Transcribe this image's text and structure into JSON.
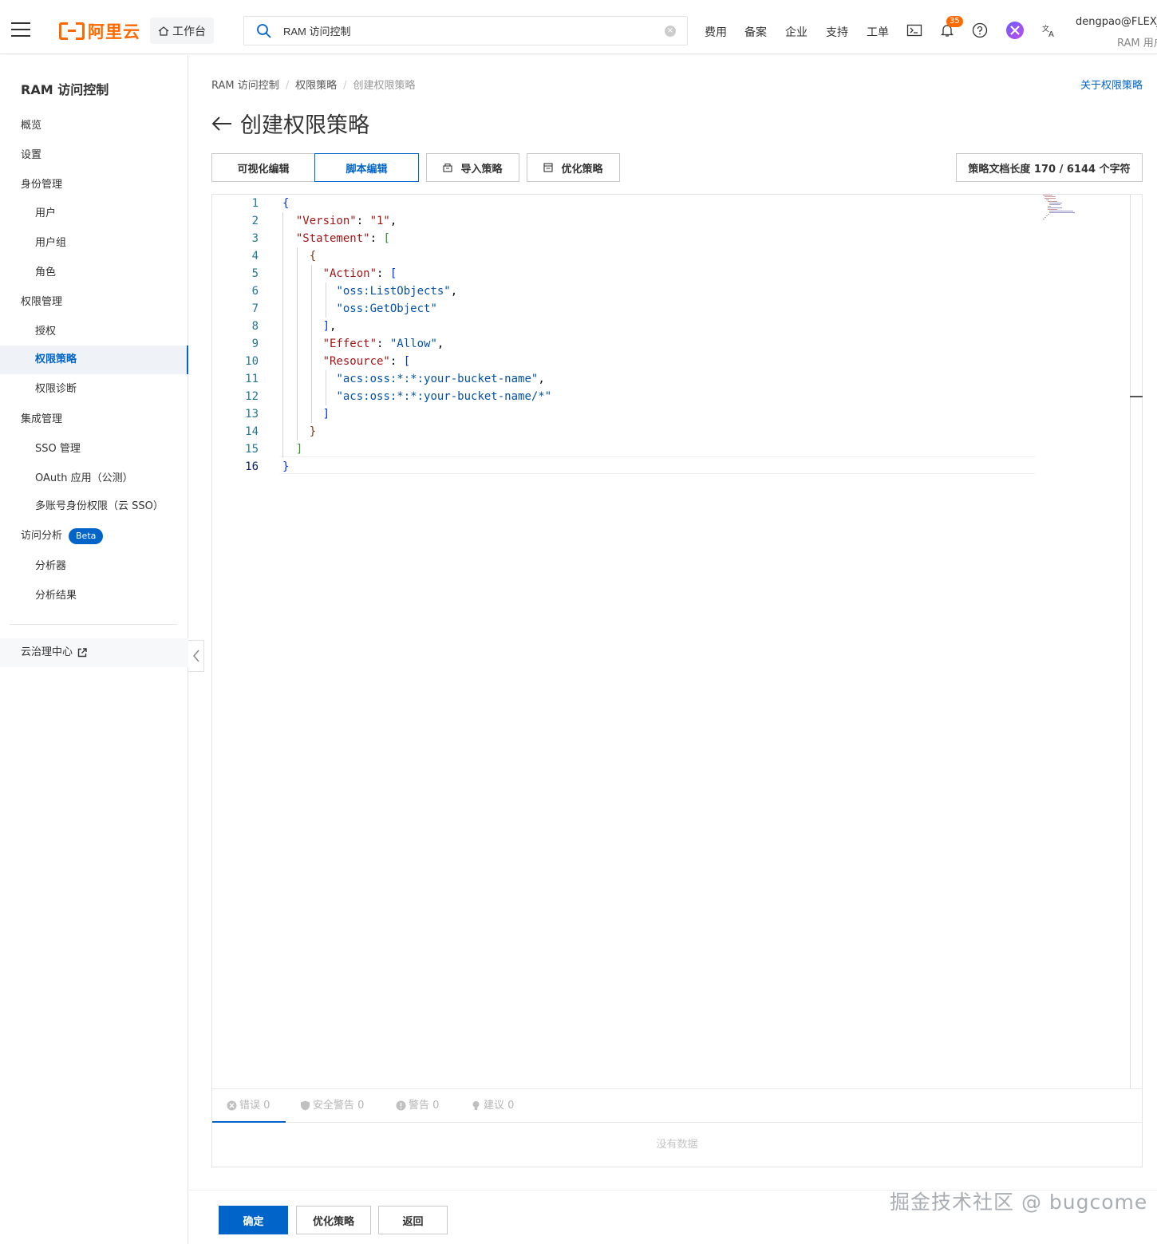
{
  "topbar": {
    "logo_text": "阿里云",
    "workbench_label": "工作台",
    "search_value": "RAM 访问控制",
    "nav": [
      "费用",
      "备案",
      "企业",
      "支持",
      "工单"
    ],
    "notification_count": "35",
    "username": "dengpao@FLEXJ",
    "user_sub": "RAM 用户"
  },
  "sidebar": {
    "title": "RAM 访问控制",
    "items": [
      {
        "label": "概览",
        "level": 1
      },
      {
        "label": "设置",
        "level": 1
      },
      {
        "label": "身份管理",
        "level": 1
      },
      {
        "label": "用户",
        "level": 2
      },
      {
        "label": "用户组",
        "level": 2
      },
      {
        "label": "角色",
        "level": 2
      },
      {
        "label": "权限管理",
        "level": 1
      },
      {
        "label": "授权",
        "level": 2
      },
      {
        "label": "权限策略",
        "level": 2,
        "active": true
      },
      {
        "label": "权限诊断",
        "level": 2
      },
      {
        "label": "集成管理",
        "level": 1
      },
      {
        "label": "SSO 管理",
        "level": 2
      },
      {
        "label": "OAuth 应用（公测）",
        "level": 2
      },
      {
        "label": "多账号身份权限（云 SSO）",
        "level": 2
      },
      {
        "label": "访问分析",
        "level": 1,
        "badge": "Beta"
      },
      {
        "label": "分析器",
        "level": 2
      },
      {
        "label": "分析结果",
        "level": 2
      }
    ],
    "external_link": "云治理中心"
  },
  "main": {
    "breadcrumb": [
      "RAM 访问控制",
      "权限策略",
      "创建权限策略"
    ],
    "about_link": "关于权限策略",
    "page_title": "创建权限策略",
    "tabs": {
      "visual": "可视化编辑",
      "script": "脚本编辑",
      "import": "导入策略",
      "optimize": "优化策略"
    },
    "doc_length": "策略文档长度 170 / 6144 个字符",
    "code_lines": [
      "{",
      "  \"Version\": \"1\",",
      "  \"Statement\": [",
      "    {",
      "      \"Action\": [",
      "        \"oss:ListObjects\",",
      "        \"oss:GetObject\"",
      "      ],",
      "      \"Effect\": \"Allow\",",
      "      \"Resource\": [",
      "        \"acs:oss:*:*:your-bucket-name\",",
      "        \"acs:oss:*:*:your-bucket-name/*\"",
      "      ]",
      "    }",
      "  ]",
      "}"
    ],
    "diagnostics": {
      "errors": "错误 0",
      "security": "安全警告 0",
      "warnings": "警告 0",
      "suggestions": "建议 0",
      "empty": "没有数据"
    },
    "footer": {
      "confirm": "确定",
      "optimize": "优化策略",
      "back": "返回"
    },
    "watermark": "掘金技术社区 @ bugcome"
  }
}
